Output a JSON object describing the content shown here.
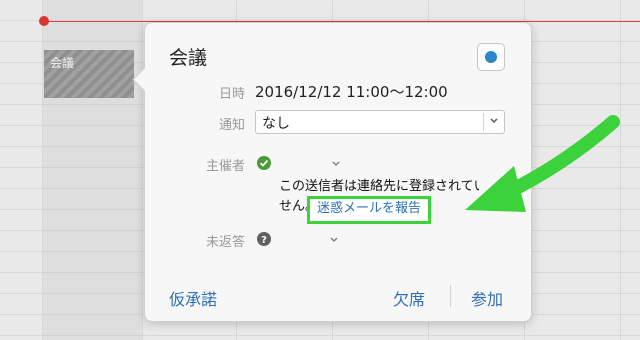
{
  "calendar": {
    "event_title": "会議"
  },
  "popover": {
    "title": "会議",
    "calendar_color": "#2c86c9",
    "rows": {
      "datetime_label": "日時",
      "datetime_value": "2016/12/12 11:00〜12:00",
      "alert_label": "通知",
      "alert_value": "なし",
      "organizer_label": "主催者",
      "organizer_notice": "この送信者は連絡先に登録されてい\nせん。",
      "report_link": "迷惑メールを報告",
      "no_response_label": "未返答"
    },
    "footer": {
      "tentative": "仮承諾",
      "decline": "欠席",
      "accept": "参加"
    }
  },
  "colors": {
    "highlight_green": "#3bd23b",
    "link_blue": "#2f6fb8",
    "now_red": "#d33"
  },
  "icons": {
    "organizer_status": "checkmark-circle-icon",
    "invitee_status": "question-circle-icon",
    "annotation": "green-arrow-icon"
  }
}
